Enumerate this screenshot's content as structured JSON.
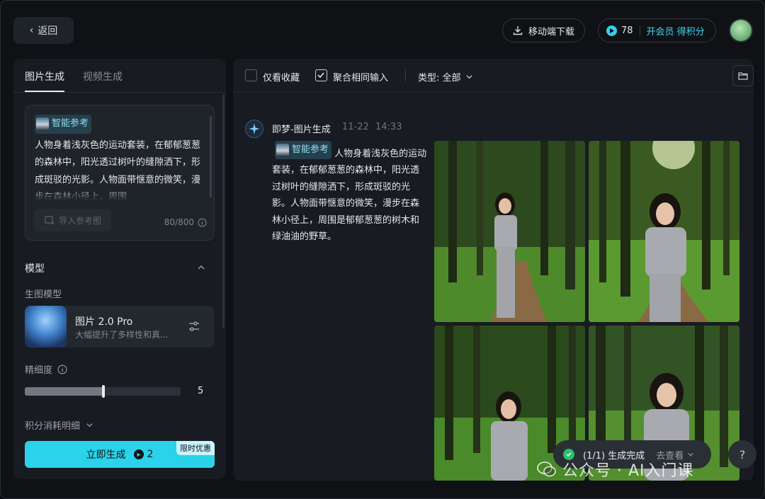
{
  "header": {
    "back_label": "返回",
    "download_label": "移动端下载",
    "points_count": "78",
    "member_label": "开会员 得积分"
  },
  "left": {
    "tabs": [
      "图片生成",
      "视频生成"
    ],
    "active_tab": "图片生成",
    "chip_label": "智能参考",
    "prompt_text": "人物身着浅灰色的运动套装，在郁郁葱葱的森林中，阳光透过树叶的缝隙洒下，形成斑驳的光影。人物面带惬意的微笑，漫步在森林小径上，周围",
    "import_ref_label": "导入参考图",
    "char_count": "80/800",
    "model_section": "模型",
    "model_sub_label": "生图模型",
    "model_name": "图片 2.0 Pro",
    "model_desc": "大幅提升了多样性和真...",
    "precision_label": "精细度",
    "precision_value": "5",
    "precision_fraction": 0.5,
    "cost_detail_label": "积分消耗明细",
    "generate_label": "立即生成",
    "generate_cost": "2",
    "promo_label": "限时优惠"
  },
  "right": {
    "only_fav_label": "仅看收藏",
    "merge_label": "聚合相同输入",
    "type_label": "类型: 全部",
    "source_name": "即梦-图片生成",
    "date": "11-22",
    "time": "14:33",
    "chip_label": "智能参考",
    "prompt_text": "人物身着浅灰色的运动套装，在郁郁葱葱的森林中，阳光透过树叶的缝隙洒下，形成斑驳的光影。人物面带惬意的微笑，漫步在森林小径上，周围是郁郁葱葱的树木和绿油油的野草。"
  },
  "toast": {
    "status": "(1/1) 生成完成",
    "link": "去查看"
  },
  "help_label": "?",
  "watermark": "公众号 · AI入门课",
  "colors": {
    "accent": "#2ad3ea",
    "background": "#0f1115",
    "panel": "#181b21",
    "success": "#27c26a"
  }
}
